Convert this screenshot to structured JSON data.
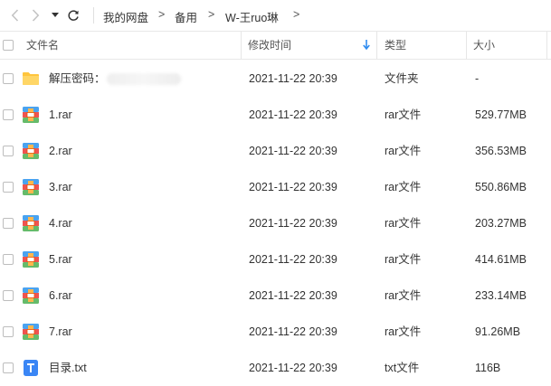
{
  "breadcrumb": {
    "items": [
      "我的网盘",
      "备用",
      "W-王ruo琳"
    ],
    "separator": ">"
  },
  "columns": {
    "name": "文件名",
    "modified": "修改时间",
    "type": "类型",
    "size": "大小"
  },
  "sort": {
    "column": "modified",
    "direction": "descending"
  },
  "colors": {
    "accent": "#2f8cf0",
    "folder": "#ffc53d",
    "txt_icon": "#3a86f5"
  },
  "files": [
    {
      "name": "解压密码：",
      "modified": "2021-11-22 20:39",
      "type": "文件夹",
      "size": "-",
      "icon": "folder-icon",
      "redacted": true
    },
    {
      "name": "1.rar",
      "modified": "2021-11-22 20:39",
      "type": "rar文件",
      "size": "529.77MB",
      "icon": "archive-icon"
    },
    {
      "name": "2.rar",
      "modified": "2021-11-22 20:39",
      "type": "rar文件",
      "size": "356.53MB",
      "icon": "archive-icon"
    },
    {
      "name": "3.rar",
      "modified": "2021-11-22 20:39",
      "type": "rar文件",
      "size": "550.86MB",
      "icon": "archive-icon"
    },
    {
      "name": "4.rar",
      "modified": "2021-11-22 20:39",
      "type": "rar文件",
      "size": "203.27MB",
      "icon": "archive-icon"
    },
    {
      "name": "5.rar",
      "modified": "2021-11-22 20:39",
      "type": "rar文件",
      "size": "414.61MB",
      "icon": "archive-icon"
    },
    {
      "name": "6.rar",
      "modified": "2021-11-22 20:39",
      "type": "rar文件",
      "size": "233.14MB",
      "icon": "archive-icon"
    },
    {
      "name": "7.rar",
      "modified": "2021-11-22 20:39",
      "type": "rar文件",
      "size": "91.26MB",
      "icon": "archive-icon"
    },
    {
      "name": "目录.txt",
      "modified": "2021-11-22 20:39",
      "type": "txt文件",
      "size": "116B",
      "icon": "text-file-icon"
    }
  ]
}
